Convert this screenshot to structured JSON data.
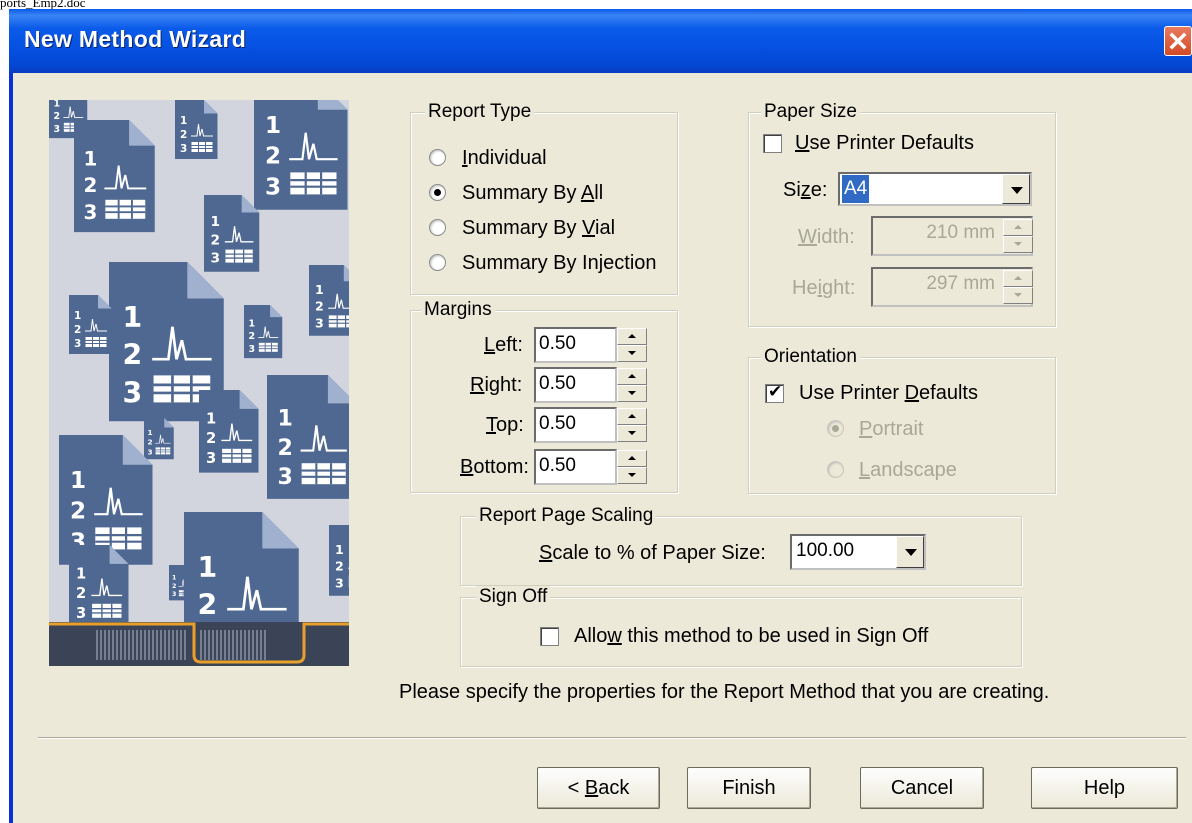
{
  "document_name": "ports_Emp2.doc",
  "window": {
    "title": "New Method Wizard",
    "close_icon": "close-icon",
    "accent": "#0831d9"
  },
  "report_type": {
    "legend": "Report Type",
    "options": [
      {
        "label_pre": "",
        "label_key": "I",
        "label_post": "ndividual",
        "selected": false
      },
      {
        "label_pre": "Summary By ",
        "label_key": "A",
        "label_post": "ll",
        "selected": true
      },
      {
        "label_pre": "Summary By ",
        "label_key": "V",
        "label_post": "ial",
        "selected": false
      },
      {
        "label_pre": "Summary By Injection",
        "label_key": "",
        "label_post": "",
        "selected": false
      }
    ]
  },
  "margins": {
    "legend": "Margins",
    "left": {
      "label_key": "L",
      "label_post": "eft:",
      "value": "0.50"
    },
    "right": {
      "label_key": "R",
      "label_post": "ight:",
      "value": "0.50"
    },
    "top": {
      "label_key": "T",
      "label_post": "op:",
      "value": "0.50"
    },
    "bottom": {
      "label_key": "B",
      "label_post": "ottom:",
      "value": "0.50"
    }
  },
  "paper_size": {
    "legend": "Paper Size",
    "use_printer_defaults": {
      "label_key": "U",
      "label_post": "se Printer Defaults",
      "checked": false
    },
    "size": {
      "label_pre": "Si",
      "label_key": "z",
      "label_post": "e:",
      "value": "A4"
    },
    "width": {
      "label_key": "W",
      "label_post": "idth:",
      "value": "210 mm"
    },
    "height": {
      "label_pre": "He",
      "label_key": "i",
      "label_post": "ght:",
      "value": "297 mm"
    }
  },
  "orientation": {
    "legend": "Orientation",
    "use_printer_defaults": {
      "label_pre": "Use Printer ",
      "label_key": "D",
      "label_post": "efaults",
      "checked": true
    },
    "portrait": {
      "label_key": "P",
      "label_post": "ortrait",
      "selected": true
    },
    "landscape": {
      "label_key": "L",
      "label_post": "andscape",
      "selected": false
    }
  },
  "scaling": {
    "legend": "Report Page Scaling",
    "label_key": "S",
    "label_post": "cale to % of Paper Size:",
    "value": "100.00"
  },
  "sign_off": {
    "legend": "Sign Off",
    "label_pre": "Allo",
    "label_key": "w",
    "label_post": " this method to be used in Sign Off",
    "checked": false
  },
  "instruction": "Please specify the properties for the Report Method that you are creating.",
  "buttons": {
    "back_arrow": "< ",
    "back_key": "B",
    "back_post": "ack",
    "finish": "Finish",
    "cancel": "Cancel",
    "help": "Help"
  }
}
